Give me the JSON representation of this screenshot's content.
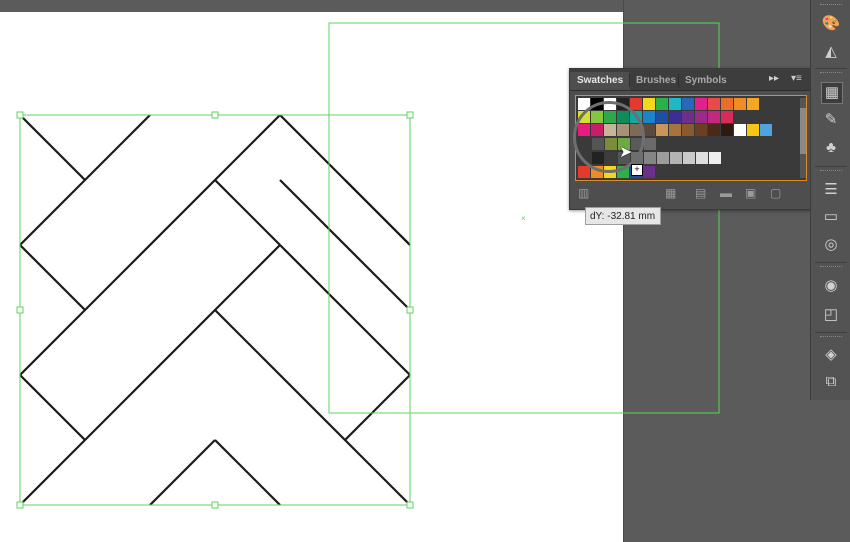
{
  "panel": {
    "tabs": [
      "Swatches",
      "Brushes",
      "Symbols"
    ],
    "menu_glyph": "▸▸",
    "options_glyph": "▾≡",
    "bottom_icons": [
      "swatch-libraries-icon",
      "show-swatch-kinds-icon",
      "swatch-options-icon",
      "new-color-group-icon",
      "new-swatch-icon",
      "delete-swatch-icon"
    ]
  },
  "tooltip": {
    "text": "dY: -32.81 mm"
  },
  "cursor": {
    "plus": "+"
  },
  "swatches": {
    "row1": [
      "#ffffff",
      "#000000",
      "#ffffff",
      "#222222",
      "#e43a2b",
      "#f5d71e",
      "#2bb14a",
      "#1fb8c4",
      "#2b67b8",
      "#e0208c",
      "#e84a4a",
      "#e86e2a",
      "#f08c26",
      "#f5a623"
    ],
    "row2": [
      "#d4e22b",
      "#88c53f",
      "#2ea84a",
      "#0f8c5b",
      "#16a6a4",
      "#1a85c8",
      "#1f4fa0",
      "#3b3092",
      "#6d2f8c",
      "#9b2a8b",
      "#c3287f",
      "#d72b5c"
    ],
    "row3": [
      "#e61c80",
      "#c81e6a",
      "#c8b49a",
      "#a89276",
      "#7f6a57",
      "#5a4a3e",
      "#c8965a",
      "#a8743e",
      "#8a5a2e",
      "#6a3f22",
      "#4a2a16",
      "#2e1a0e",
      "#ffffff",
      "#f5c518",
      "#4fa3e0"
    ],
    "row4": [
      "#555555",
      "#7b8c3a",
      "#6ea844",
      "#5a5a5a",
      "#6a6a6a"
    ],
    "row5": [
      "#222222",
      "#3d3d3d",
      "#555555",
      "#6e6e6e",
      "#858585",
      "#9c9c9c",
      "#b3b3b3",
      "#cacaca",
      "#dedede",
      "#efefef"
    ],
    "row6": [
      "#e43a2b",
      "#f08c26",
      "#f5d71e",
      "#2bb14a",
      "#1f4fa0",
      "#6d2f8c"
    ]
  },
  "toolbar": {
    "icons": [
      "color-guide-icon",
      "color-panel-icon",
      "swatches-panel-icon",
      "brushes-panel-icon",
      "symbols-panel-icon",
      "stroke-panel-icon",
      "gradient-panel-icon",
      "transparency-panel-icon",
      "appearance-panel-icon",
      "graphic-styles-icon",
      "layers-panel-icon",
      "artboards-panel-icon"
    ]
  }
}
